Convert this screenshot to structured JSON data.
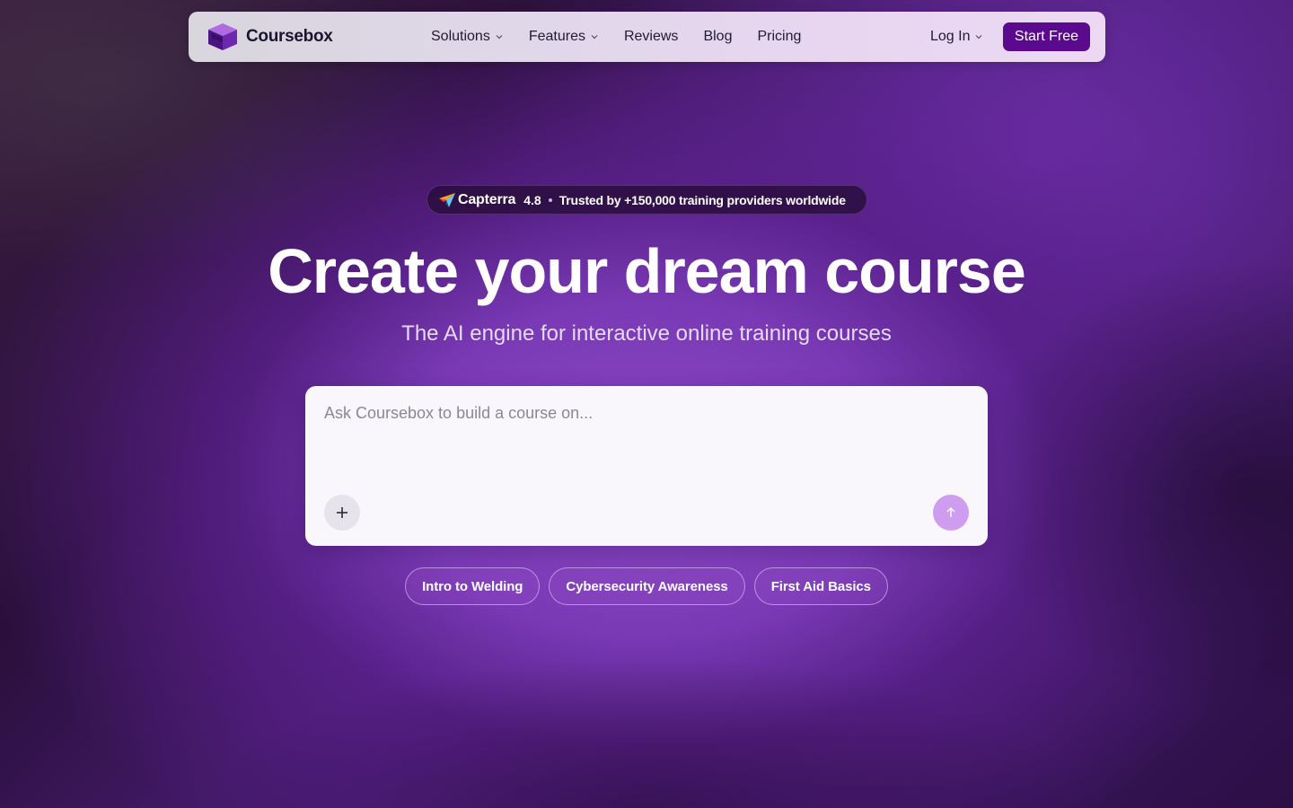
{
  "nav": {
    "logo_text": "Coursebox",
    "links": [
      {
        "label": "Solutions",
        "has_dropdown": true
      },
      {
        "label": "Features",
        "has_dropdown": true
      },
      {
        "label": "Reviews",
        "has_dropdown": false
      },
      {
        "label": "Blog",
        "has_dropdown": false
      },
      {
        "label": "Pricing",
        "has_dropdown": false
      }
    ],
    "login_label": "Log In",
    "cta_label": "Start Free"
  },
  "badge": {
    "brand": "Capterra",
    "rating": "4.8",
    "trusted_text": "Trusted by +150,000 training providers worldwide"
  },
  "hero": {
    "title": "Create your dream course",
    "subtitle": "The AI engine for interactive online training courses"
  },
  "prompt": {
    "placeholder": "Ask Coursebox to build a course on..."
  },
  "suggestions": [
    {
      "label": "Intro to Welding"
    },
    {
      "label": "Cybersecurity Awareness"
    },
    {
      "label": "First Aid Basics"
    }
  ],
  "icons": {
    "logo": "graduation-cap-cube-icon",
    "dropdown": "chevron-down-icon",
    "capterra": "capterra-arrow-icon",
    "add": "plus-icon",
    "send": "arrow-up-icon"
  },
  "colors": {
    "cta_bg": "#5b0a8f",
    "send_bg": "#cf9df0",
    "hero_bg": "#7a3ab6"
  }
}
